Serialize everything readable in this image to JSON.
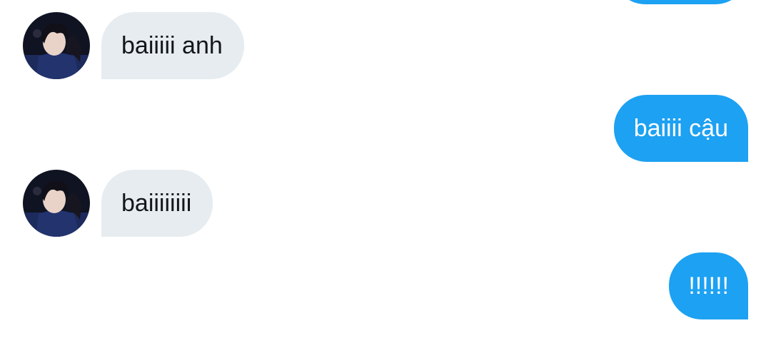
{
  "conversation": {
    "messages": [
      {
        "direction": "outgoing",
        "text": "",
        "avatar": "",
        "partial": true
      },
      {
        "direction": "incoming",
        "text": "baiiiii anh",
        "avatar": "contact-avatar"
      },
      {
        "direction": "outgoing",
        "text": "baiiii cậu"
      },
      {
        "direction": "incoming",
        "text": "baiiiiiiii",
        "avatar": "contact-avatar"
      },
      {
        "direction": "outgoing",
        "text": "!!!!!!"
      }
    ]
  },
  "colors": {
    "incoming_bubble": "#e6ecf0",
    "incoming_text": "#14171a",
    "outgoing_bubble": "#1da1f2",
    "outgoing_text": "#ffffff",
    "background": "#ffffff"
  }
}
